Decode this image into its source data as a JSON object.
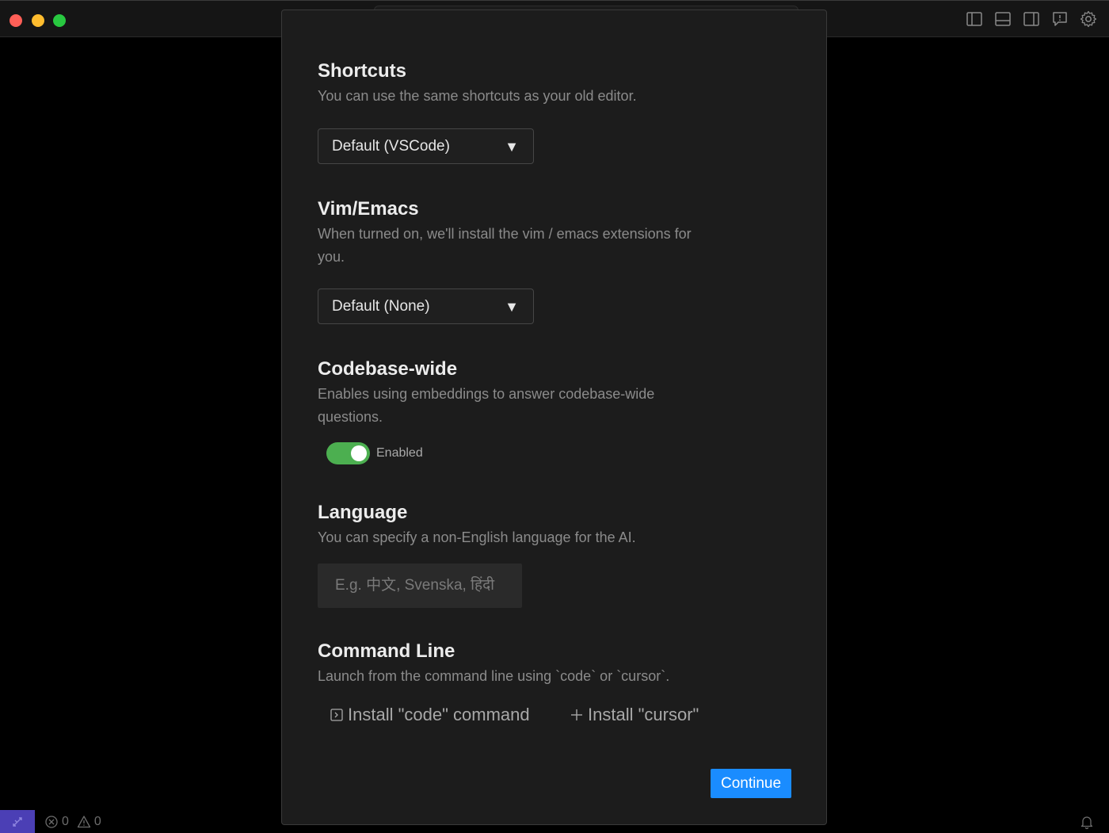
{
  "window": {
    "traffic_lights": [
      "close",
      "minimize",
      "maximize"
    ],
    "titlebar_icons": [
      "toggle-primary-sidebar-icon",
      "toggle-panel-icon",
      "toggle-secondary-sidebar-icon",
      "feedback-icon",
      "settings-gear-icon"
    ]
  },
  "onboarding": {
    "shortcuts": {
      "title": "Shortcuts",
      "description": "You can use the same shortcuts as your old editor.",
      "selected": "Default (VSCode)"
    },
    "vim_emacs": {
      "title": "Vim/Emacs",
      "description": "When turned on, we'll install the vim / emacs extensions for you.",
      "selected": "Default (None)"
    },
    "codebase": {
      "title": "Codebase-wide",
      "description": "Enables using embeddings to answer codebase-wide questions.",
      "toggle_label": "Enabled",
      "enabled": true
    },
    "language": {
      "title": "Language",
      "description": "You can specify a non-English language for the AI.",
      "placeholder": "E.g. 中文, Svenska, हिंदी",
      "value": ""
    },
    "command_line": {
      "title": "Command Line",
      "description": "Launch from the command line using `code` or `cursor`.",
      "install_code": "Install \"code\" command",
      "install_cursor": "Install \"cursor\""
    },
    "continue_label": "Continue"
  },
  "statusbar": {
    "errors": "0",
    "warnings": "0"
  },
  "colors": {
    "accent": "#1a8cff",
    "toggle_on": "#4caf50",
    "remote": "#4b3fb5"
  }
}
